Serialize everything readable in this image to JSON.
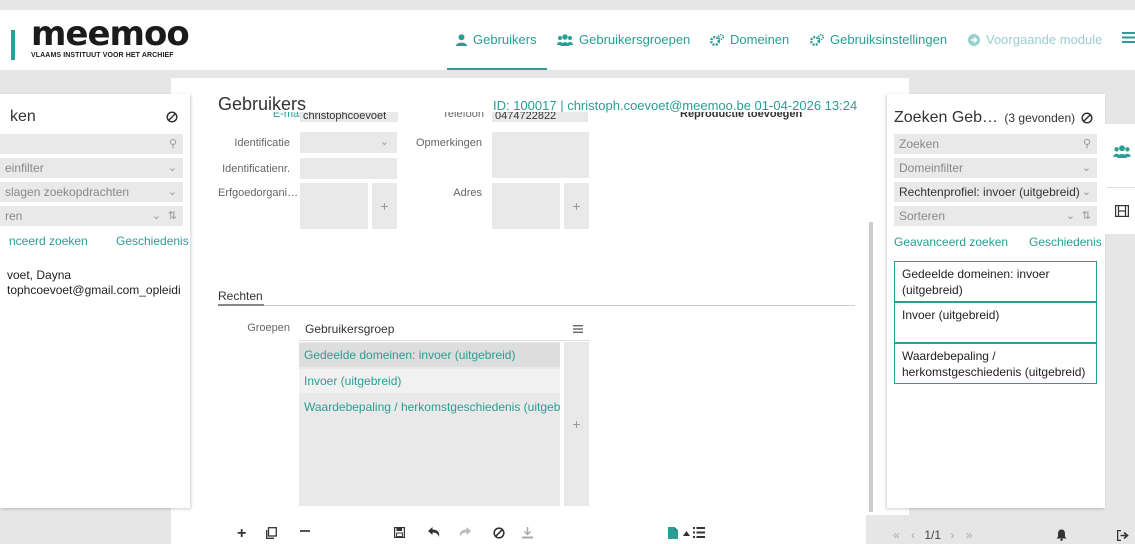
{
  "app": {
    "logo": "meemoo",
    "logo_sub": "VLAAMS INSTITUUT VOOR HET ARCHIEF"
  },
  "nav": {
    "items": [
      {
        "label": "Gebruikers",
        "icon": "user-icon"
      },
      {
        "label": "Gebruikersgroepen",
        "icon": "users-icon"
      },
      {
        "label": "Domeinen",
        "icon": "cogs-icon"
      },
      {
        "label": "Gebruiksinstellingen",
        "icon": "cogs-icon"
      },
      {
        "label": "Voorgaande module",
        "icon": "arrow-circle-icon"
      }
    ]
  },
  "left": {
    "title": "ken",
    "domain_filter": "einfilter",
    "saved_searches": "slagen zoekopdrachten",
    "sort": "ren",
    "advanced": "nceerd zoeken",
    "history": "Geschiedenis",
    "result_name": "voet, Dayna",
    "result_email": "tophcoevoet@gmail.com_opleidi"
  },
  "main": {
    "title": "Gebruikers",
    "id_line": "ID: 100017 | christoph.coevoet@meemoo.be 01-04-2026 13:24",
    "email_label": "E-mail",
    "email_value": "christophcoevoet",
    "phone_label": "Telefoon",
    "phone_value": "0474722822",
    "repro_label": "Reproductie toevoegen",
    "ident_label": "Identificatie",
    "remarks_label": "Opmerkingen",
    "identnr_label": "Identificatienr.",
    "heritage_label": "Erfgoedorgani…",
    "address_label": "Adres",
    "rights_tab": "Rechten",
    "groups_label": "Groepen",
    "groups_header": "Gebruikersgroep",
    "groups": [
      "Gedeelde domeinen: invoer (uitgebreid)",
      "Invoer (uitgebreid)",
      "Waardebepaling / herkomstgeschiedenis (uitgebreid)"
    ]
  },
  "right": {
    "title": "Zoeken Geb…",
    "count": "(3 gevonden)",
    "search_placeholder": "Zoeken",
    "domain_filter": "Domeinfilter",
    "rights_profile": "Rechtenprofiel: invoer (uitgebreid)",
    "sort": "Sorteren",
    "advanced": "Geavanceerd zoeken",
    "history": "Geschiedenis",
    "results": [
      "Gedeelde domeinen: invoer (uitgebreid)",
      "Invoer (uitgebreid)",
      "Waardebepaling / herkomstgeschiedenis (uitgebreid)"
    ],
    "pager": "1/1"
  },
  "colors": {
    "accent": "#2a9d94",
    "field_bg": "#e9e9e9",
    "page_bg": "#e6e6e6"
  }
}
